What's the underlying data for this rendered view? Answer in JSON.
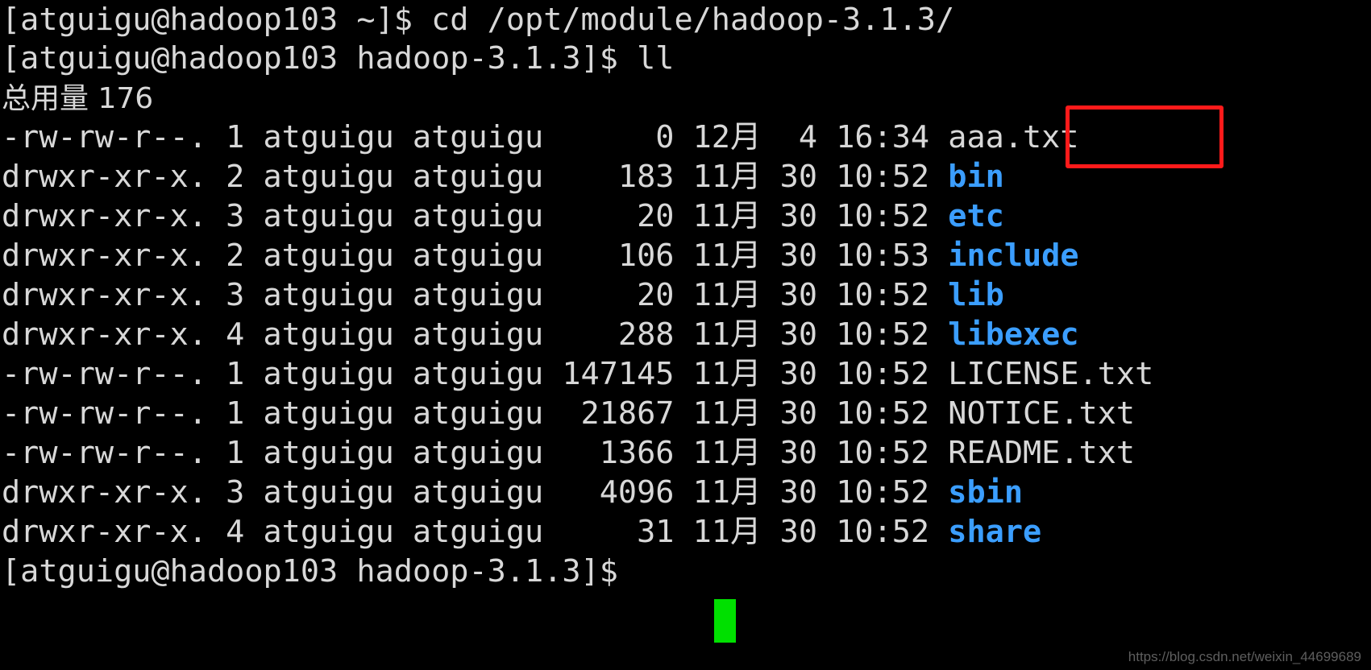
{
  "terminal": {
    "background_color": "#000000",
    "foreground_color": "#d8d8d8",
    "directory_color": "#3b9eff",
    "highlight_color": "#ff1a1a",
    "cursor_color": "#00e000",
    "prompt_line_1": "[atguigu@hadoop103 ~]$ cd /opt/module/hadoop-3.1.3/",
    "prompt_line_2": "[atguigu@hadoop103 hadoop-3.1.3]$ ll",
    "total_line": "总用量 176",
    "final_prompt": "[atguigu@hadoop103 hadoop-3.1.3]$ ",
    "listing": [
      {
        "prefix": "-rw-rw-r--. 1 atguigu atguigu      0 12月  4 16:34 ",
        "permissions": "-rw-rw-r--.",
        "links": "1",
        "owner": "atguigu",
        "group": "atguigu",
        "size": "0",
        "month": "12月",
        "day": "4",
        "time": "16:34",
        "name": "aaa.txt",
        "type": "file",
        "highlighted": true
      },
      {
        "prefix": "drwxr-xr-x. 2 atguigu atguigu    183 11月 30 10:52 ",
        "permissions": "drwxr-xr-x.",
        "links": "2",
        "owner": "atguigu",
        "group": "atguigu",
        "size": "183",
        "month": "11月",
        "day": "30",
        "time": "10:52",
        "name": "bin",
        "type": "directory",
        "highlighted": false
      },
      {
        "prefix": "drwxr-xr-x. 3 atguigu atguigu     20 11月 30 10:52 ",
        "permissions": "drwxr-xr-x.",
        "links": "3",
        "owner": "atguigu",
        "group": "atguigu",
        "size": "20",
        "month": "11月",
        "day": "30",
        "time": "10:52",
        "name": "etc",
        "type": "directory",
        "highlighted": false
      },
      {
        "prefix": "drwxr-xr-x. 2 atguigu atguigu    106 11月 30 10:53 ",
        "permissions": "drwxr-xr-x.",
        "links": "2",
        "owner": "atguigu",
        "group": "atguigu",
        "size": "106",
        "month": "11月",
        "day": "30",
        "time": "10:53",
        "name": "include",
        "type": "directory",
        "highlighted": false
      },
      {
        "prefix": "drwxr-xr-x. 3 atguigu atguigu     20 11月 30 10:52 ",
        "permissions": "drwxr-xr-x.",
        "links": "3",
        "owner": "atguigu",
        "group": "atguigu",
        "size": "20",
        "month": "11月",
        "day": "30",
        "time": "10:52",
        "name": "lib",
        "type": "directory",
        "highlighted": false
      },
      {
        "prefix": "drwxr-xr-x. 4 atguigu atguigu    288 11月 30 10:52 ",
        "permissions": "drwxr-xr-x.",
        "links": "4",
        "owner": "atguigu",
        "group": "atguigu",
        "size": "288",
        "month": "11月",
        "day": "30",
        "time": "10:52",
        "name": "libexec",
        "type": "directory",
        "highlighted": false
      },
      {
        "prefix": "-rw-rw-r--. 1 atguigu atguigu 147145 11月 30 10:52 ",
        "permissions": "-rw-rw-r--.",
        "links": "1",
        "owner": "atguigu",
        "group": "atguigu",
        "size": "147145",
        "month": "11月",
        "day": "30",
        "time": "10:52",
        "name": "LICENSE.txt",
        "type": "file",
        "highlighted": false
      },
      {
        "prefix": "-rw-rw-r--. 1 atguigu atguigu  21867 11月 30 10:52 ",
        "permissions": "-rw-rw-r--.",
        "links": "1",
        "owner": "atguigu",
        "group": "atguigu",
        "size": "21867",
        "month": "11月",
        "day": "30",
        "time": "10:52",
        "name": "NOTICE.txt",
        "type": "file",
        "highlighted": false
      },
      {
        "prefix": "-rw-rw-r--. 1 atguigu atguigu   1366 11月 30 10:52 ",
        "permissions": "-rw-rw-r--.",
        "links": "1",
        "owner": "atguigu",
        "group": "atguigu",
        "size": "1366",
        "month": "11月",
        "day": "30",
        "time": "10:52",
        "name": "README.txt",
        "type": "file",
        "highlighted": false
      },
      {
        "prefix": "drwxr-xr-x. 3 atguigu atguigu   4096 11月 30 10:52 ",
        "permissions": "drwxr-xr-x.",
        "links": "3",
        "owner": "atguigu",
        "group": "atguigu",
        "size": "4096",
        "month": "11月",
        "day": "30",
        "time": "10:52",
        "name": "sbin",
        "type": "directory",
        "highlighted": false
      },
      {
        "prefix": "drwxr-xr-x. 4 atguigu atguigu     31 11月 30 10:52 ",
        "permissions": "drwxr-xr-x.",
        "links": "4",
        "owner": "atguigu",
        "group": "atguigu",
        "size": "31",
        "month": "11月",
        "day": "30",
        "time": "10:52",
        "name": "share",
        "type": "directory",
        "highlighted": false
      }
    ]
  },
  "watermark": {
    "text": "https://blog.csdn.net/weixin_44699689"
  }
}
